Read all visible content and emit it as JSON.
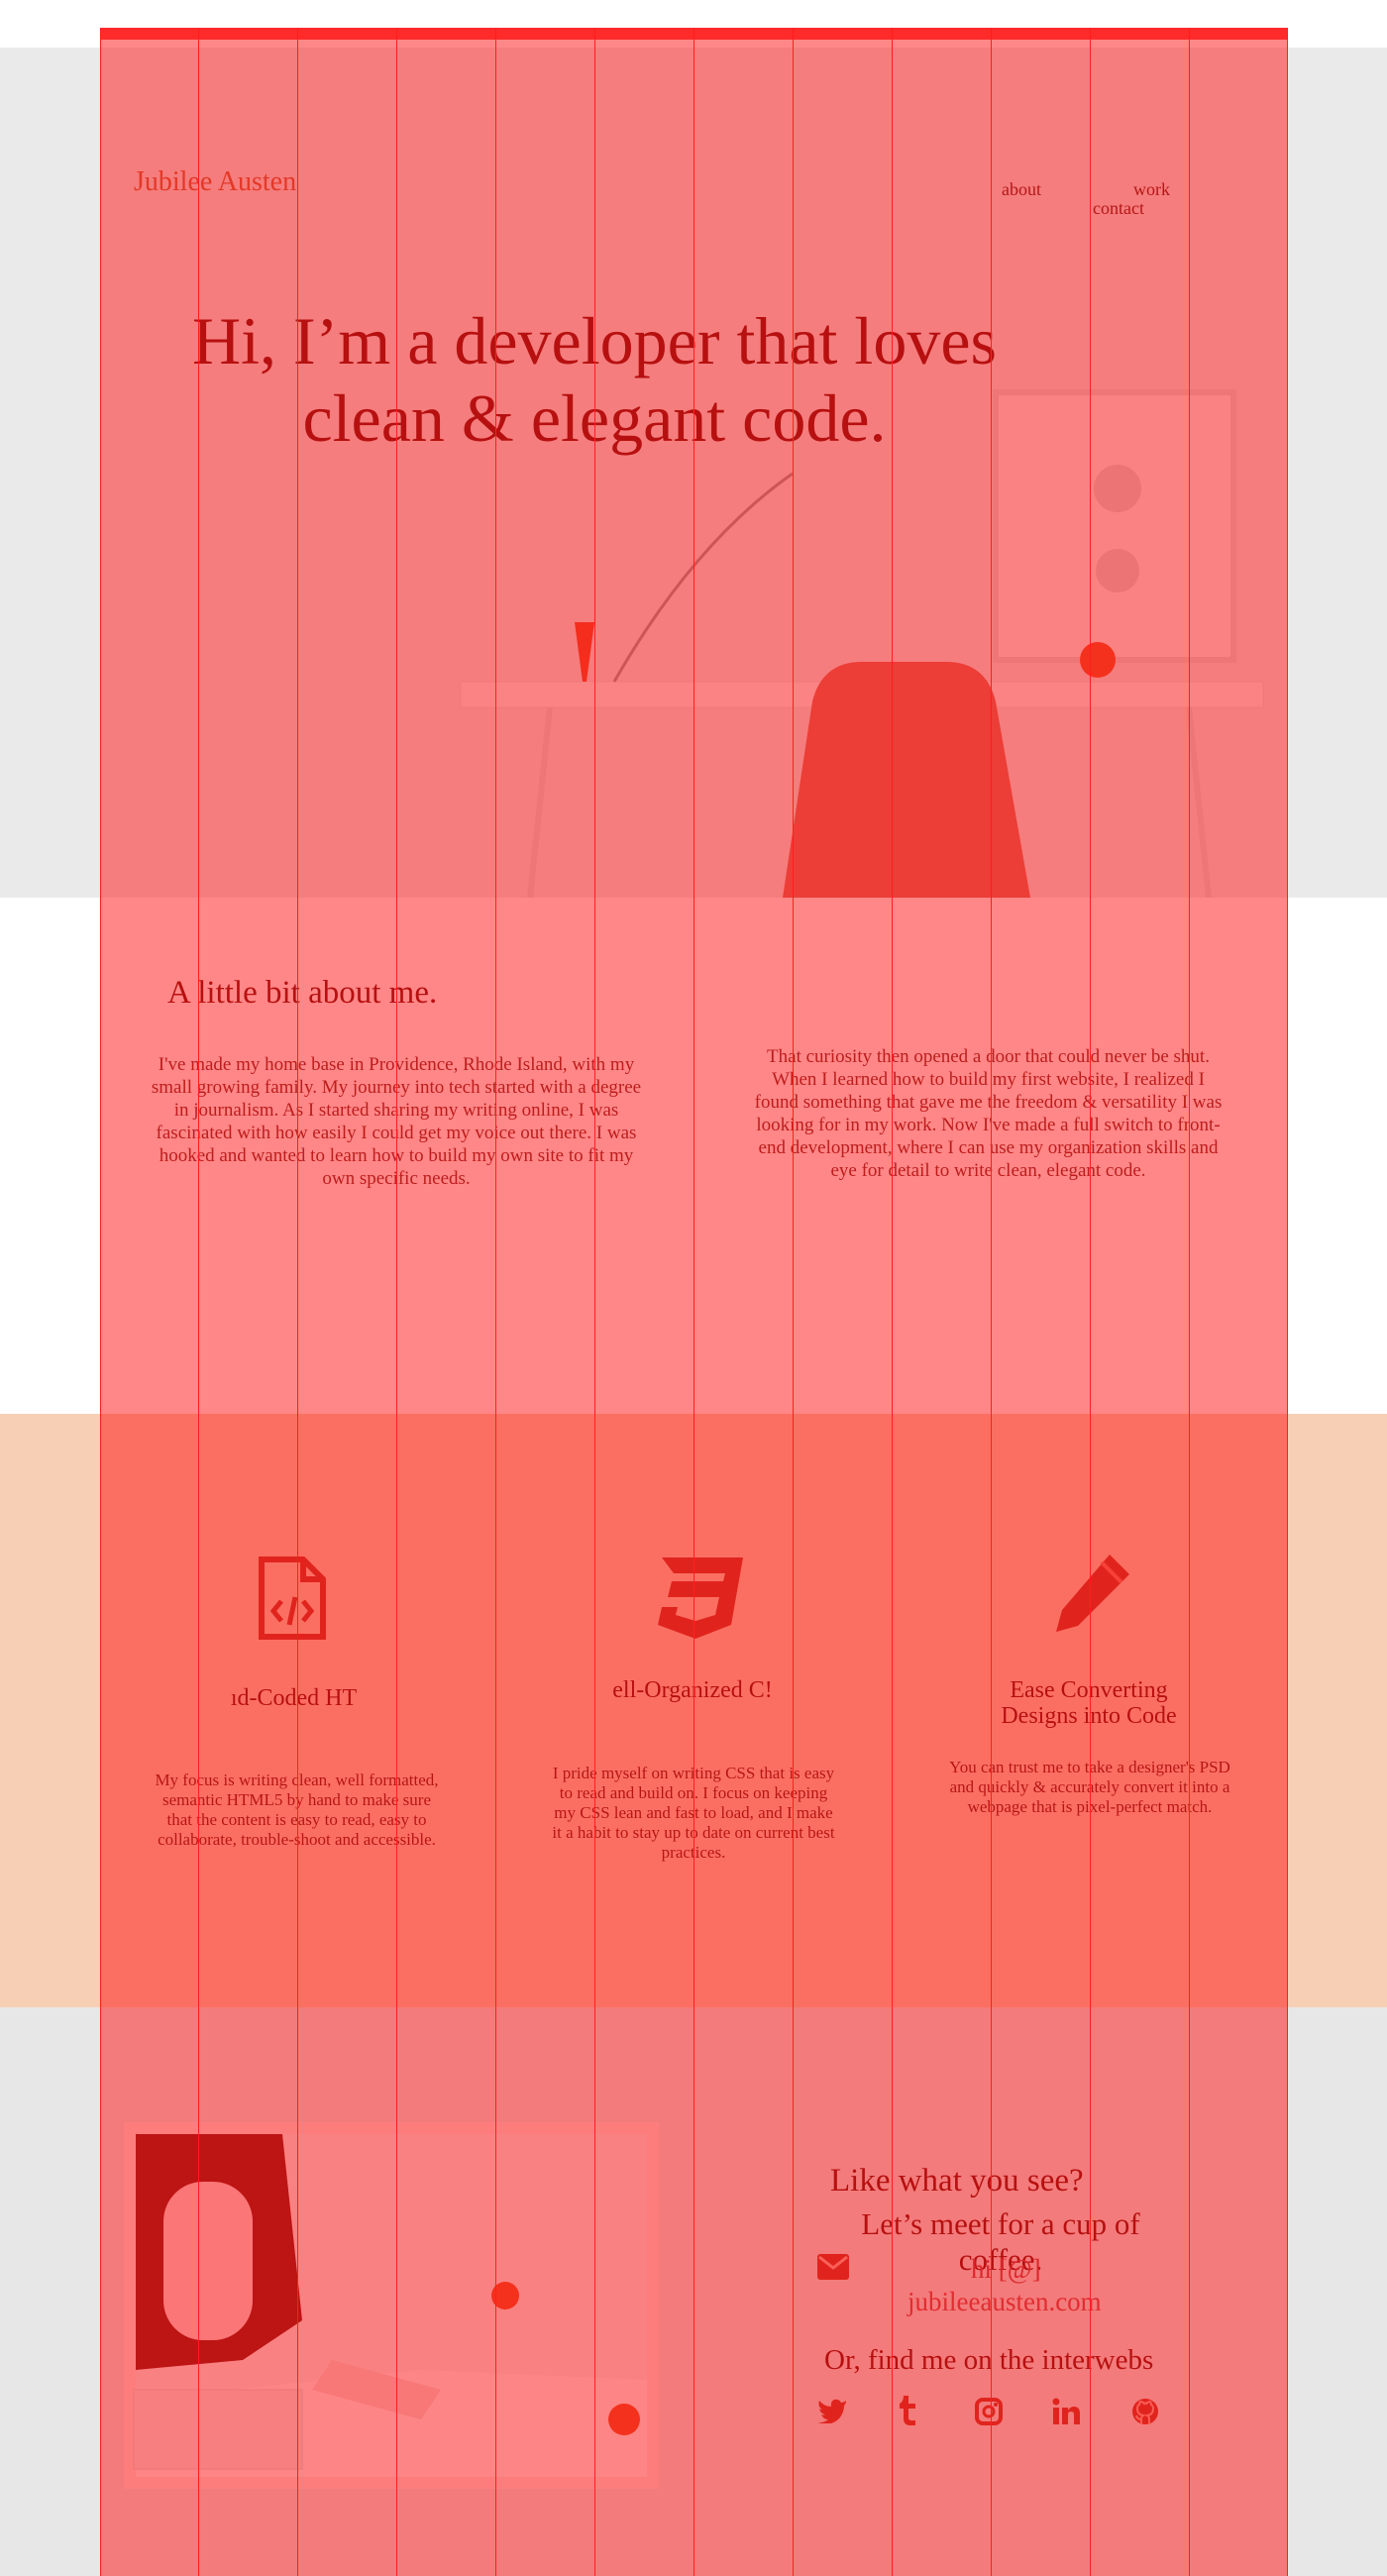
{
  "brand": {
    "name": "Jubilee Austen"
  },
  "nav": {
    "about": "about",
    "work": "work",
    "contact": "contact"
  },
  "hero": {
    "title": "Hi, I’m a developer that loves clean & elegant code."
  },
  "about": {
    "title": "A little bit about me.",
    "p1": "I've made my home base in Providence, Rhode Island, with my small growing family. My journey into tech started with a degree in journalism. As I started sharing my writing online, I was fascinated with how easily I could get my voice out there. I was hooked and wanted to learn how to build my own site to fit my own specific needs.",
    "p2": "That curiosity then opened a door that could never be shut. When I learned how to build my first website, I realized I found something that gave me the freedom & versatility I was looking for in my work. Now I've made a full switch to front-end development, where I can use my organization skills and eye for detail to write clean, elegant code."
  },
  "skills": [
    {
      "title": "ıd-Coded HT",
      "text": "My focus is writing clean, well formatted, semantic HTML5 by hand to make sure that the content is easy to read, easy to collaborate, trouble-shoot and accessible.",
      "icon": "file-code-icon"
    },
    {
      "title": "ell-Organized C!",
      "text": "I pride myself on writing CSS that is easy to read and build on. I focus on keeping my CSS lean and fast to load, and I make it a habit to stay up to date on current best practices.",
      "icon": "css3-icon"
    },
    {
      "title": "Ease Converting Designs into Code",
      "text": "You can trust me to take a designer's PSD and quickly & accurately convert it into a webpage that is pixel-perfect match.",
      "icon": "pencil-icon"
    }
  ],
  "contact": {
    "title": "Like what you see?",
    "subtitle": "Let’s meet for a cup of coffee.",
    "hello": "hi [@]",
    "email": "jubileeausten.com",
    "find": "Or, find me on the interwebs"
  },
  "social": [
    "twitter-icon",
    "tumblr-icon",
    "instagram-icon",
    "linkedin-icon",
    "github-icon"
  ],
  "colors": {
    "overlay": "#ff0f0f",
    "peach": "#f7cfb4",
    "gray": "#eaeaea",
    "accent": "#c8613e"
  }
}
